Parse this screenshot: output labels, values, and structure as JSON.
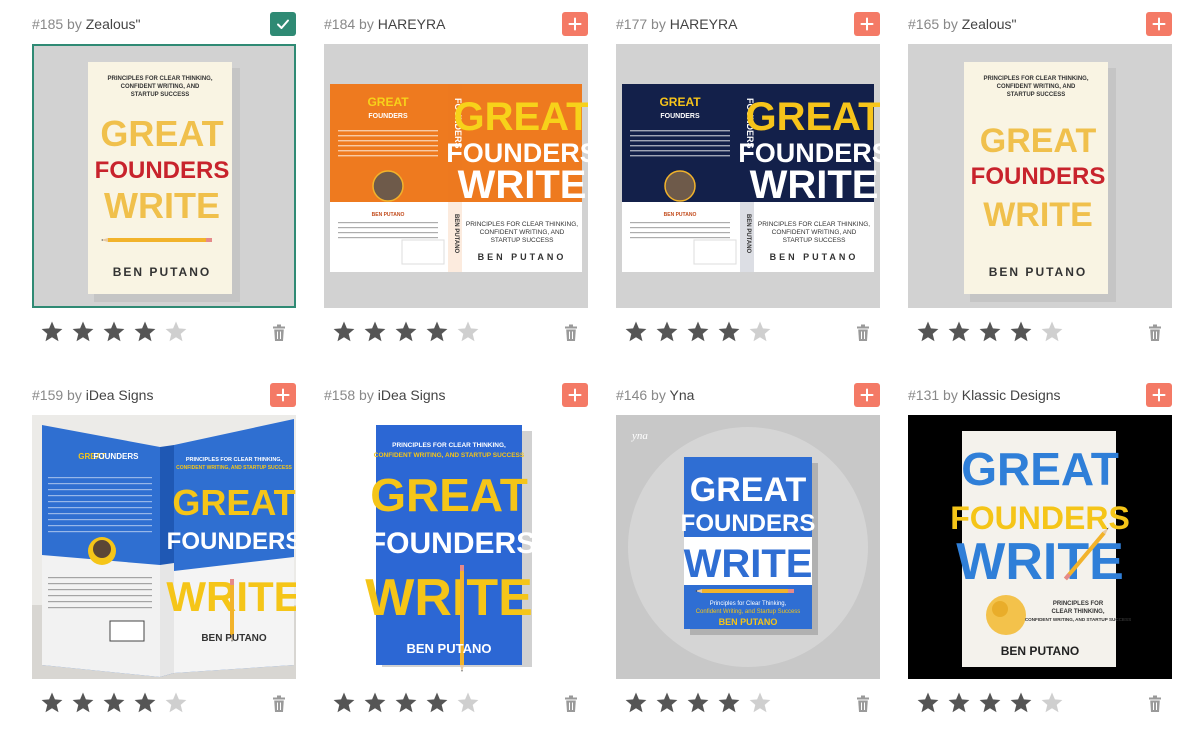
{
  "colors": {
    "add_button": "#f47a66",
    "selected_button": "#2f8a74",
    "star_filled": "#555555",
    "star_empty": "#cfcfcf",
    "trash": "#9a9a9a"
  },
  "entries": [
    {
      "number": "#185",
      "by": "by",
      "designer": "Zealous\"",
      "state": "selected",
      "rating": 4,
      "cover": {
        "style": "cream-flat",
        "line1": "PRINCIPLES FOR CLEAR THINKING,",
        "line2": "CONFIDENT WRITING, AND",
        "line3": "STARTUP SUCCESS",
        "title1": "GREAT",
        "title2": "FOUNDERS",
        "title3": "WRITE",
        "author": "BEN PUTANO"
      }
    },
    {
      "number": "#184",
      "by": "by",
      "designer": "HAREYRA",
      "state": "add",
      "rating": 4,
      "cover": {
        "style": "orange-spread",
        "line1": "PRINCIPLES FOR CLEAR THINKING,",
        "line2": "CONFIDENT WRITING, AND",
        "line3": "STARTUP SUCCESS",
        "title1": "GREAT",
        "title2": "FOUNDERS",
        "title3": "WRITE",
        "author": "BEN PUTANO"
      }
    },
    {
      "number": "#177",
      "by": "by",
      "designer": "HAREYRA",
      "state": "add",
      "rating": 4,
      "cover": {
        "style": "navy-spread",
        "line1": "PRINCIPLES FOR CLEAR THINKING,",
        "line2": "CONFIDENT WRITING, AND",
        "line3": "STARTUP SUCCESS",
        "title1": "GREAT",
        "title2": "FOUNDERS",
        "title3": "WRITE",
        "author": "BEN PUTANO"
      }
    },
    {
      "number": "#165",
      "by": "by",
      "designer": "Zealous\"",
      "state": "add",
      "rating": 4,
      "cover": {
        "style": "cream-plain",
        "line1": "PRINCIPLES FOR CLEAR THINKING,",
        "line2": "CONFIDENT WRITING, AND",
        "line3": "STARTUP SUCCESS",
        "title1": "GREAT",
        "title2": "FOUNDERS",
        "title3": "WRITE",
        "author": "BEN PUTANO"
      }
    },
    {
      "number": "#159",
      "by": "by",
      "designer": "iDea Signs",
      "state": "add",
      "rating": 4,
      "cover": {
        "style": "blue-3d",
        "line1": "PRINCIPLES FOR CLEAR THINKING,",
        "line2": "CONFIDENT WRITING, AND STARTUP SUCCESS",
        "line3": "",
        "title1": "GREAT",
        "title2": "FOUNDERS",
        "title3": "WRITE",
        "author": "BEN PUTANO"
      }
    },
    {
      "number": "#158",
      "by": "by",
      "designer": "iDea Signs",
      "state": "add",
      "rating": 4,
      "cover": {
        "style": "blue-flat",
        "line1": "PRINCIPLES FOR CLEAR THINKING,",
        "line2": "CONFIDENT WRITING, AND STARTUP SUCCESS",
        "line3": "",
        "title1": "GREAT",
        "title2": "FOUNDERS",
        "title3": "WRITE",
        "author": "BEN PUTANO"
      }
    },
    {
      "number": "#146",
      "by": "by",
      "designer": "Yna",
      "state": "add",
      "rating": 4,
      "cover": {
        "style": "blue-mock",
        "line1": "Principles for Clear Thinking,",
        "line2": "Confident Writing, and Startup Success",
        "line3": "",
        "title1": "GREAT",
        "title2": "FOUNDERS",
        "title3": "WRITE",
        "author": "BEN PUTANO",
        "watermark": "yna"
      }
    },
    {
      "number": "#131",
      "by": "by",
      "designer": "Klassic Designs",
      "state": "add",
      "rating": 4,
      "cover": {
        "style": "white-on-black",
        "line1": "PRINCIPLES FOR",
        "line2": "CLEAR THINKING,",
        "line3": "CONFIDENT WRITING, AND STARTUP SUCCESS",
        "title1": "GREAT",
        "title2": "FOUNDERS",
        "title3": "WRITE",
        "author": "BEN PUTANO"
      }
    }
  ]
}
